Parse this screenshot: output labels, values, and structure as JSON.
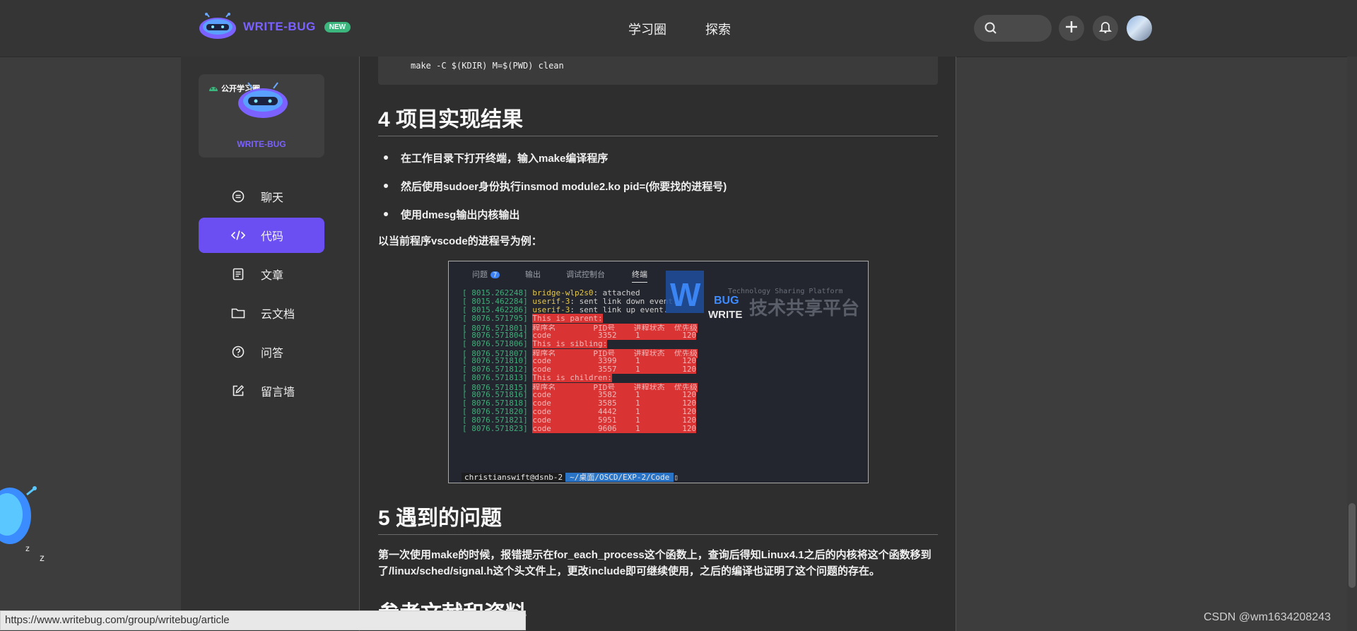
{
  "header": {
    "brand": "WRITE-BUG",
    "badge": "NEW",
    "nav": [
      "学习圈",
      "探索"
    ]
  },
  "sidebar": {
    "circle_label": "公开学习圈",
    "circle_brand": "WRITE-BUG",
    "items": [
      {
        "label": "聊天",
        "icon": "chat-icon",
        "active": false
      },
      {
        "label": "代码",
        "icon": "code-icon",
        "active": true
      },
      {
        "label": "文章",
        "icon": "article-icon",
        "active": false
      },
      {
        "label": "云文档",
        "icon": "folder-icon",
        "active": false
      },
      {
        "label": "问答",
        "icon": "question-icon",
        "active": false
      },
      {
        "label": "留言墙",
        "icon": "edit-icon",
        "active": false
      }
    ]
  },
  "article": {
    "code_line": "make -C $(KDIR) M=$(PWD) clean",
    "section4_title": "4 项目实现结果",
    "bullets": [
      "在工作目录下打开终端，输入make编译程序",
      "然后使用sudoer身份执行insmod module2.ko pid=(你要找的进程号)",
      "使用dmesg输出内核输出"
    ],
    "example_text": "以当前程序vscode的进程号为例：",
    "section5_title": "5 遇到的问题",
    "problem_text": "第一次使用make的时候，报错提示在for_each_process这个函数上，查询后得知Linux4.1之后的内核将这个函数移到了/linux/sched/signal.h这个头文件上，更改include即可继续使用，之后的编译也证明了这个问题的存在。",
    "next_title_partial": "参考文献和资料"
  },
  "terminal": {
    "tabs": [
      "问题",
      "输出",
      "调试控制台",
      "终端"
    ],
    "problem_count": "7",
    "watermark_en": "Technology Sharing Platform",
    "watermark_cn": "技术共享平台",
    "watermark_bug": "BUG",
    "watermark_write": "WRITE",
    "lines": [
      {
        "ts": "[ 8015.262248]",
        "key": "bridge-wlp2s0",
        "text": ": attached",
        "red": false
      },
      {
        "ts": "[ 8015.462284]",
        "key": "userif-3",
        "text": ": sent link down event.",
        "red": false
      },
      {
        "ts": "[ 8015.462286]",
        "key": "userif-3",
        "text": ": sent link up event.",
        "red": false
      },
      {
        "ts": "[ 8076.571795]",
        "key": "",
        "text": "This is parent:",
        "red": true
      },
      {
        "ts": "[ 8076.571801]",
        "key": "",
        "text": "程序名        PID号    进程状态  优先级",
        "red": true
      },
      {
        "ts": "[ 8076.571804]",
        "key": "",
        "text": "code          3352    1         120",
        "red": true
      },
      {
        "ts": "[ 8076.571806]",
        "key": "",
        "text": "This is sibling:",
        "red": true
      },
      {
        "ts": "[ 8076.571807]",
        "key": "",
        "text": "程序名        PID号    进程状态  优先级",
        "red": true
      },
      {
        "ts": "[ 8076.571810]",
        "key": "",
        "text": "code          3399    1         120",
        "red": true
      },
      {
        "ts": "[ 8076.571812]",
        "key": "",
        "text": "code          3557    1         120",
        "red": true
      },
      {
        "ts": "[ 8076.571813]",
        "key": "",
        "text": "This is children:",
        "red": true
      },
      {
        "ts": "[ 8076.571815]",
        "key": "",
        "text": "程序名        PID号    进程状态  优先级",
        "red": true
      },
      {
        "ts": "[ 8076.571816]",
        "key": "",
        "text": "code          3582    1         120",
        "red": true
      },
      {
        "ts": "[ 8076.571818]",
        "key": "",
        "text": "code          3585    1         120",
        "red": true
      },
      {
        "ts": "[ 8076.571820]",
        "key": "",
        "text": "code          4442    1         120",
        "red": true
      },
      {
        "ts": "[ 8076.571821]",
        "key": "",
        "text": "code          5951    1         120",
        "red": true
      },
      {
        "ts": "[ 8076.571823]",
        "key": "",
        "text": "code          9606    1         120",
        "red": true
      }
    ],
    "prompt_user": "christianswift@dsnb-2",
    "prompt_path": "~/桌面/OSCD/EXP-2/Code"
  },
  "status_url": "https://www.writebug.com/group/writebug/article",
  "watermark": "CSDN @wm1634208243",
  "colors": {
    "accent": "#6b4ff2",
    "brand": "#7b61ff",
    "badge": "#3bb77e"
  }
}
